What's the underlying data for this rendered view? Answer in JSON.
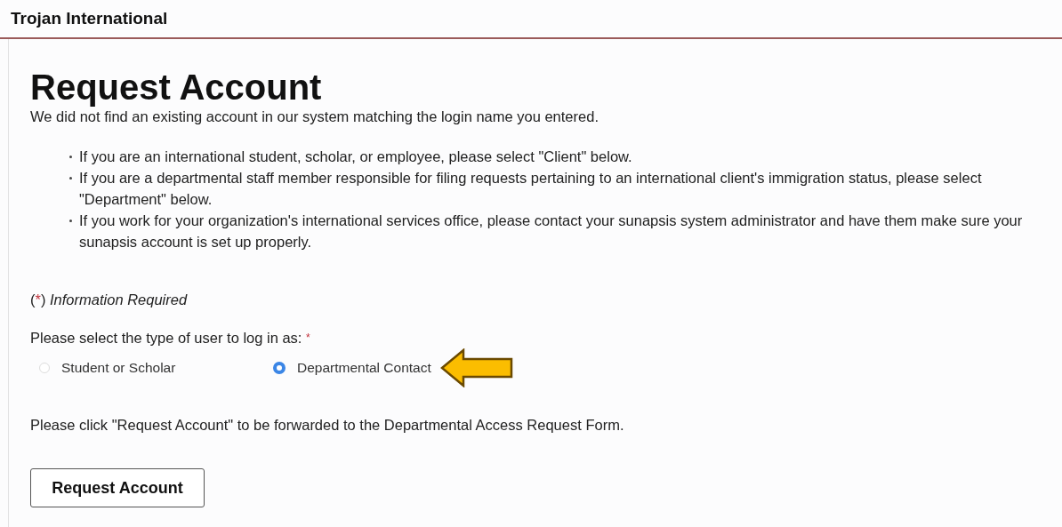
{
  "header": {
    "title": "Trojan International"
  },
  "page": {
    "title": "Request Account",
    "intro": "We did not find an existing account in our system matching the login name you entered.",
    "bullets": [
      "If you are an international student, scholar, or employee, please select \"Client\" below.",
      "If you are a departmental staff member responsible for filing requests pertaining to an international client's immigration status, please select \"Department\" below.",
      "If you work for your organization's international services office, please contact your sunapsis system administrator and have them make sure your sunapsis account is set up properly."
    ],
    "required_note": {
      "open": "(",
      "marker": "*",
      "close": ")",
      "text": "Information Required"
    },
    "question": {
      "label": "Please select the type of user to log in as:",
      "required_marker": "*"
    },
    "options": [
      {
        "label": "Student or Scholar",
        "selected": false
      },
      {
        "label": "Departmental Contact",
        "selected": true
      }
    ],
    "instruction": "Please click \"Request Account\" to be forwarded to the Departmental Access Request Form.",
    "button": "Request Account"
  }
}
